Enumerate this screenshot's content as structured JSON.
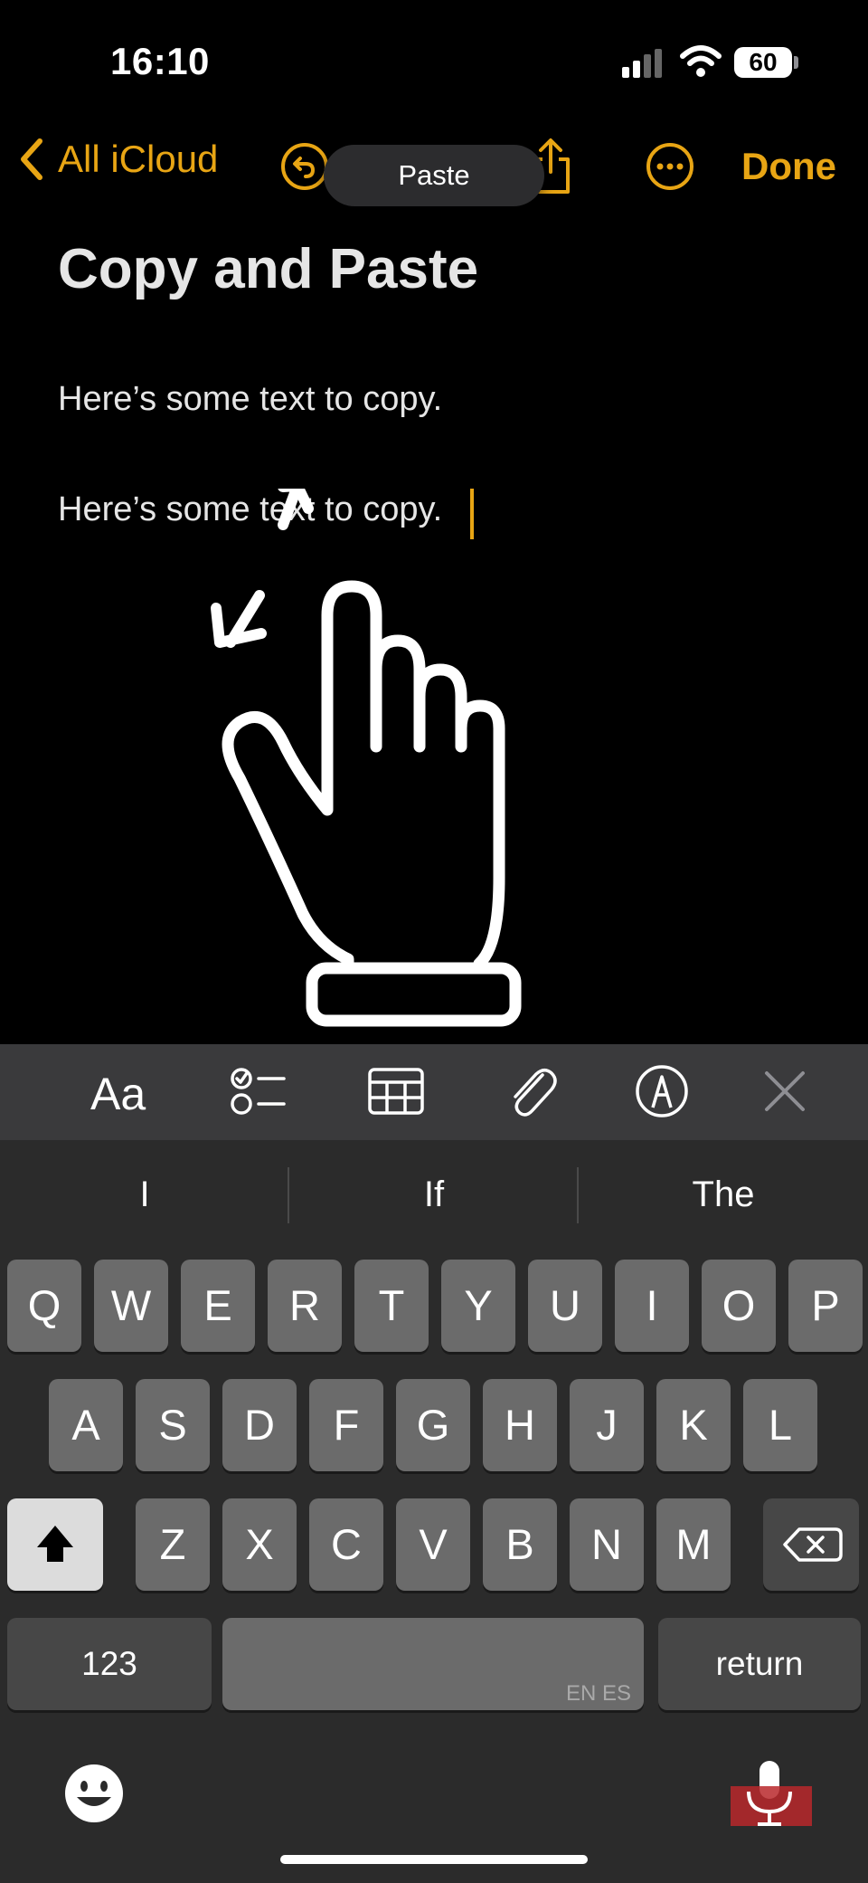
{
  "status_bar": {
    "time": "16:10",
    "battery": "60"
  },
  "nav": {
    "back_label": "All iCloud",
    "done_label": "Done",
    "paste_label": "Paste",
    "accent_color": "#e8a514"
  },
  "note": {
    "title": "Copy and Paste",
    "lines": [
      "Here’s some text to copy.",
      "Here’s some text to copy."
    ]
  },
  "format_toolbar": {
    "text_style_label": "Aa",
    "icons": [
      "checklist-icon",
      "table-icon",
      "paperclip-icon",
      "markup-pen-icon",
      "close-icon"
    ]
  },
  "keyboard": {
    "suggestions": [
      "I",
      "If",
      "The"
    ],
    "rows": [
      [
        "Q",
        "W",
        "E",
        "R",
        "T",
        "Y",
        "U",
        "I",
        "O",
        "P"
      ],
      [
        "A",
        "S",
        "D",
        "F",
        "G",
        "H",
        "J",
        "K",
        "L"
      ],
      [
        "Z",
        "X",
        "C",
        "V",
        "B",
        "N",
        "M"
      ]
    ],
    "numbers_label": "123",
    "return_label": "return",
    "space_languages": "EN ES"
  }
}
